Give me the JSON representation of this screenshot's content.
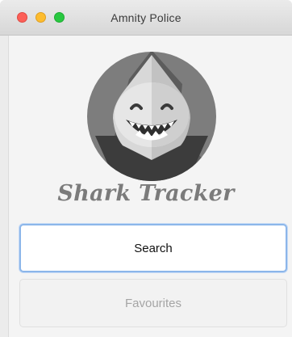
{
  "window": {
    "title": "Amnity Police",
    "controls": [
      "close",
      "minimize",
      "maximize"
    ]
  },
  "logo": {
    "icon": "shark-logo-icon",
    "app_name": "Shark Tracker"
  },
  "buttons": {
    "search_label": "Search",
    "favourites_label": "Favourites"
  },
  "colors": {
    "logo_circle": "#7d7d7d",
    "logo_shadow": "#595959",
    "app_name": "#7b7b7b",
    "focus_ring": "#8cb6ea"
  }
}
